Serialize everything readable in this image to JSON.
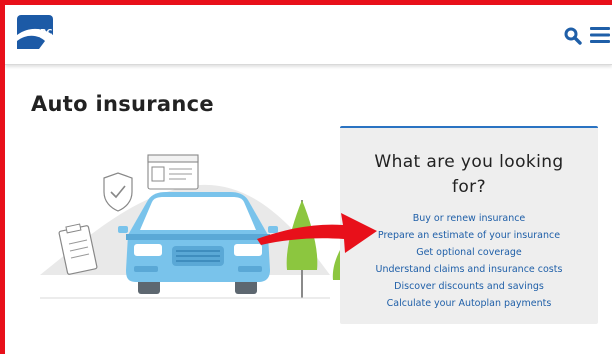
{
  "header": {
    "logo_text": "ICBC",
    "icons": {
      "search": "search-icon",
      "menu": "hamburger-menu-icon"
    },
    "accent_color": "#1f5fa8"
  },
  "main": {
    "page_title": "Auto insurance"
  },
  "panel": {
    "title_line1": "What are you looking",
    "title_line2": "for?",
    "accent_color": "#2a73c2",
    "links": [
      "Buy or renew insurance",
      "Prepare an estimate of your insurance",
      "Get optional coverage",
      "Understand claims and insurance costs",
      "Discover discounts and savings",
      "Calculate your Autoplan payments"
    ]
  },
  "annotation": {
    "arrow_color": "#e8101a"
  }
}
